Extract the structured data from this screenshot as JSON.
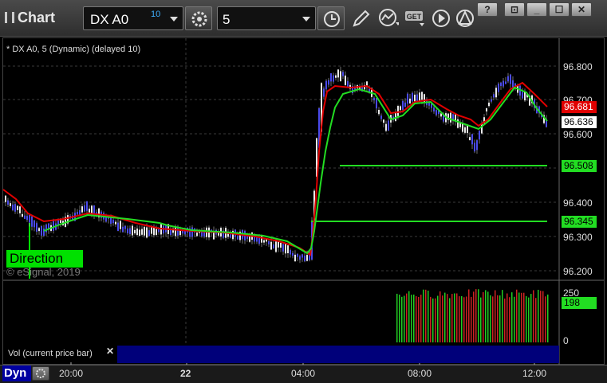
{
  "app": {
    "title": "Chart"
  },
  "toolbar": {
    "symbol": "DX A0",
    "delay": "10",
    "interval": "5"
  },
  "window_buttons": [
    "?",
    "⊡",
    "_",
    "☐",
    "✕"
  ],
  "chart": {
    "series_label": "* DX A0, 5 (Dynamic) (delayed 10)",
    "copyright": "© eSignal, 2019",
    "direction_label": "Direction",
    "price_axis": [
      "96.800",
      "96.700",
      "96.600",
      "96.400",
      "96.300",
      "96.200"
    ],
    "tags": {
      "red": "96.681",
      "last": "96.636",
      "green_upper": "96.508",
      "green_lower": "96.345"
    },
    "colors": {
      "red": "#e00000",
      "green": "#22dd22",
      "up": "#ffffff",
      "down": "#1a1aff"
    }
  },
  "volume": {
    "label": "Vol (current price bar)",
    "axis": [
      "250",
      "0"
    ],
    "tag": "198"
  },
  "bottom_bar": {
    "dyn_label": "Dyn",
    "times": [
      "20:00",
      "22",
      "04:00",
      "08:00",
      "12:00"
    ]
  }
}
